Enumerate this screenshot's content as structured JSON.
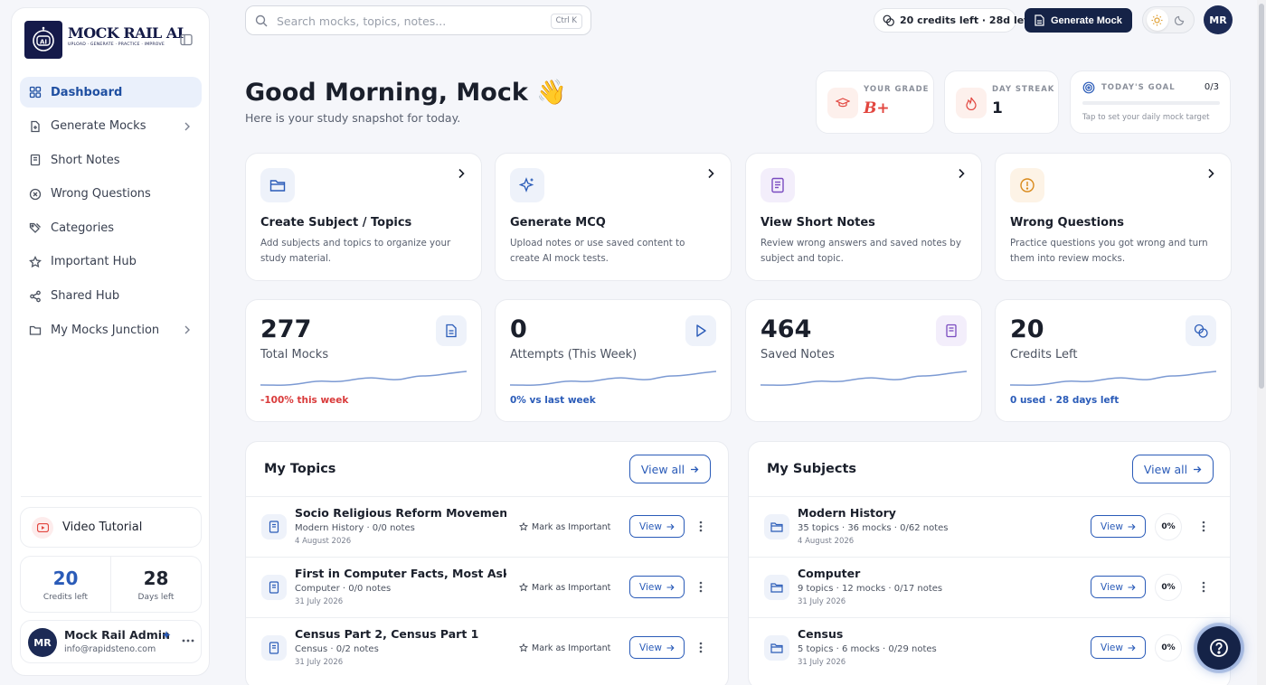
{
  "brand": {
    "name": "MOCK RAIL AI",
    "tagline": "UPLOAD · GENERATE · PRACTICE · IMPROVE",
    "logo_icon": "robot-face-icon",
    "logo_text": "AI"
  },
  "sidebar": {
    "items": [
      {
        "label": "Dashboard",
        "icon": "grid-icon"
      },
      {
        "label": "Generate Mocks",
        "icon": "document-plus-icon"
      },
      {
        "label": "Short Notes",
        "icon": "notebook-icon"
      },
      {
        "label": "Wrong Questions",
        "icon": "x-circle-icon"
      },
      {
        "label": "Categories",
        "icon": "tags-icon"
      },
      {
        "label": "Important Hub",
        "icon": "star-icon"
      },
      {
        "label": "Shared Hub",
        "icon": "share-icon"
      },
      {
        "label": "My Mocks Junction",
        "icon": "folder-icon"
      }
    ],
    "video_tutorial": "Video Tutorial",
    "stats": [
      {
        "value": "20",
        "label": "Credits left"
      },
      {
        "value": "28",
        "label": "Days left"
      }
    ],
    "user": {
      "initials": "MR",
      "name": "Mock Rail Admin",
      "email": "info@rapidsteno.com"
    }
  },
  "topbar": {
    "search_placeholder": "Search mocks, topics, notes...",
    "shortcut": "Ctrl K",
    "credits": "20 credits left · 28d left",
    "generate_label": "Generate Mock",
    "avatar_initials": "MR"
  },
  "greeting": {
    "title": "Good Morning, Mock",
    "emoji": "👋",
    "subtitle": "Here is your study snapshot for today."
  },
  "kpis": {
    "grade": {
      "label": "YOUR GRADE",
      "value": "B+"
    },
    "streak": {
      "label": "DAY STREAK",
      "value": "1"
    },
    "goal": {
      "label": "TODAY'S GOAL",
      "count": "0/3",
      "progress": 0,
      "hint": "Tap to set your daily mock target"
    }
  },
  "actions": [
    {
      "title": "Create Subject / Topics",
      "desc": "Add subjects and topics to organize your study material.",
      "icon": "folder-icon"
    },
    {
      "title": "Generate MCQ",
      "desc": "Upload notes or use saved content to create AI mock tests.",
      "icon": "sparkles-icon"
    },
    {
      "title": "View Short Notes",
      "desc": "Review wrong answers and saved notes by subject and topic.",
      "icon": "notebook-icon"
    },
    {
      "title": "Wrong Questions",
      "desc": "Practice questions you got wrong and turn them into review mocks.",
      "icon": "alert-circle-icon"
    }
  ],
  "metrics": [
    {
      "value": "277",
      "label": "Total Mocks",
      "trend": "-100% this week",
      "trend_color": "#d93a3a",
      "icon": "document-icon"
    },
    {
      "value": "0",
      "label": "Attempts (This Week)",
      "trend": "0% vs last week",
      "trend_color": "#2a5bb8",
      "icon": "play-icon"
    },
    {
      "value": "464",
      "label": "Saved Notes",
      "trend": "",
      "trend_color": "#2a5bb8",
      "icon": "notebook-icon"
    },
    {
      "value": "20",
      "label": "Credits Left",
      "trend": "0 used · 28 days left",
      "trend_color": "#2a5bb8",
      "icon": "coins-icon"
    }
  ],
  "topics": {
    "title": "My Topics",
    "view_all": "View all",
    "mark_label": "Mark as Important",
    "view_label": "View",
    "rows": [
      {
        "title": "Socio Religious Reform Movements",
        "meta": "Modern History · 0/0 notes",
        "date": "4 August 2026"
      },
      {
        "title": "First in Computer Facts, Most Asked in Exams",
        "meta": "Computer · 0/0 notes",
        "date": "31 July 2026"
      },
      {
        "title": "Census Part 2, Census Part 1",
        "meta": "Census · 0/2 notes",
        "date": "31 July 2026"
      }
    ]
  },
  "subjects": {
    "title": "My Subjects",
    "view_all": "View all",
    "view_label": "View",
    "rows": [
      {
        "title": "Modern History",
        "meta": "35 topics · 36 mocks · 0/62 notes",
        "date": "4 August 2026",
        "pct": "0%"
      },
      {
        "title": "Computer",
        "meta": "9 topics · 12 mocks · 0/17 notes",
        "date": "31 July 2026",
        "pct": "0%"
      },
      {
        "title": "Census",
        "meta": "5 topics · 6 mocks · 0/29 notes",
        "date": "31 July 2026",
        "pct": "0%"
      }
    ]
  },
  "colors": {
    "accent": "#2a5bb8",
    "navy": "#152347",
    "negative": "#d93a3a",
    "grade": "#e2463f"
  }
}
